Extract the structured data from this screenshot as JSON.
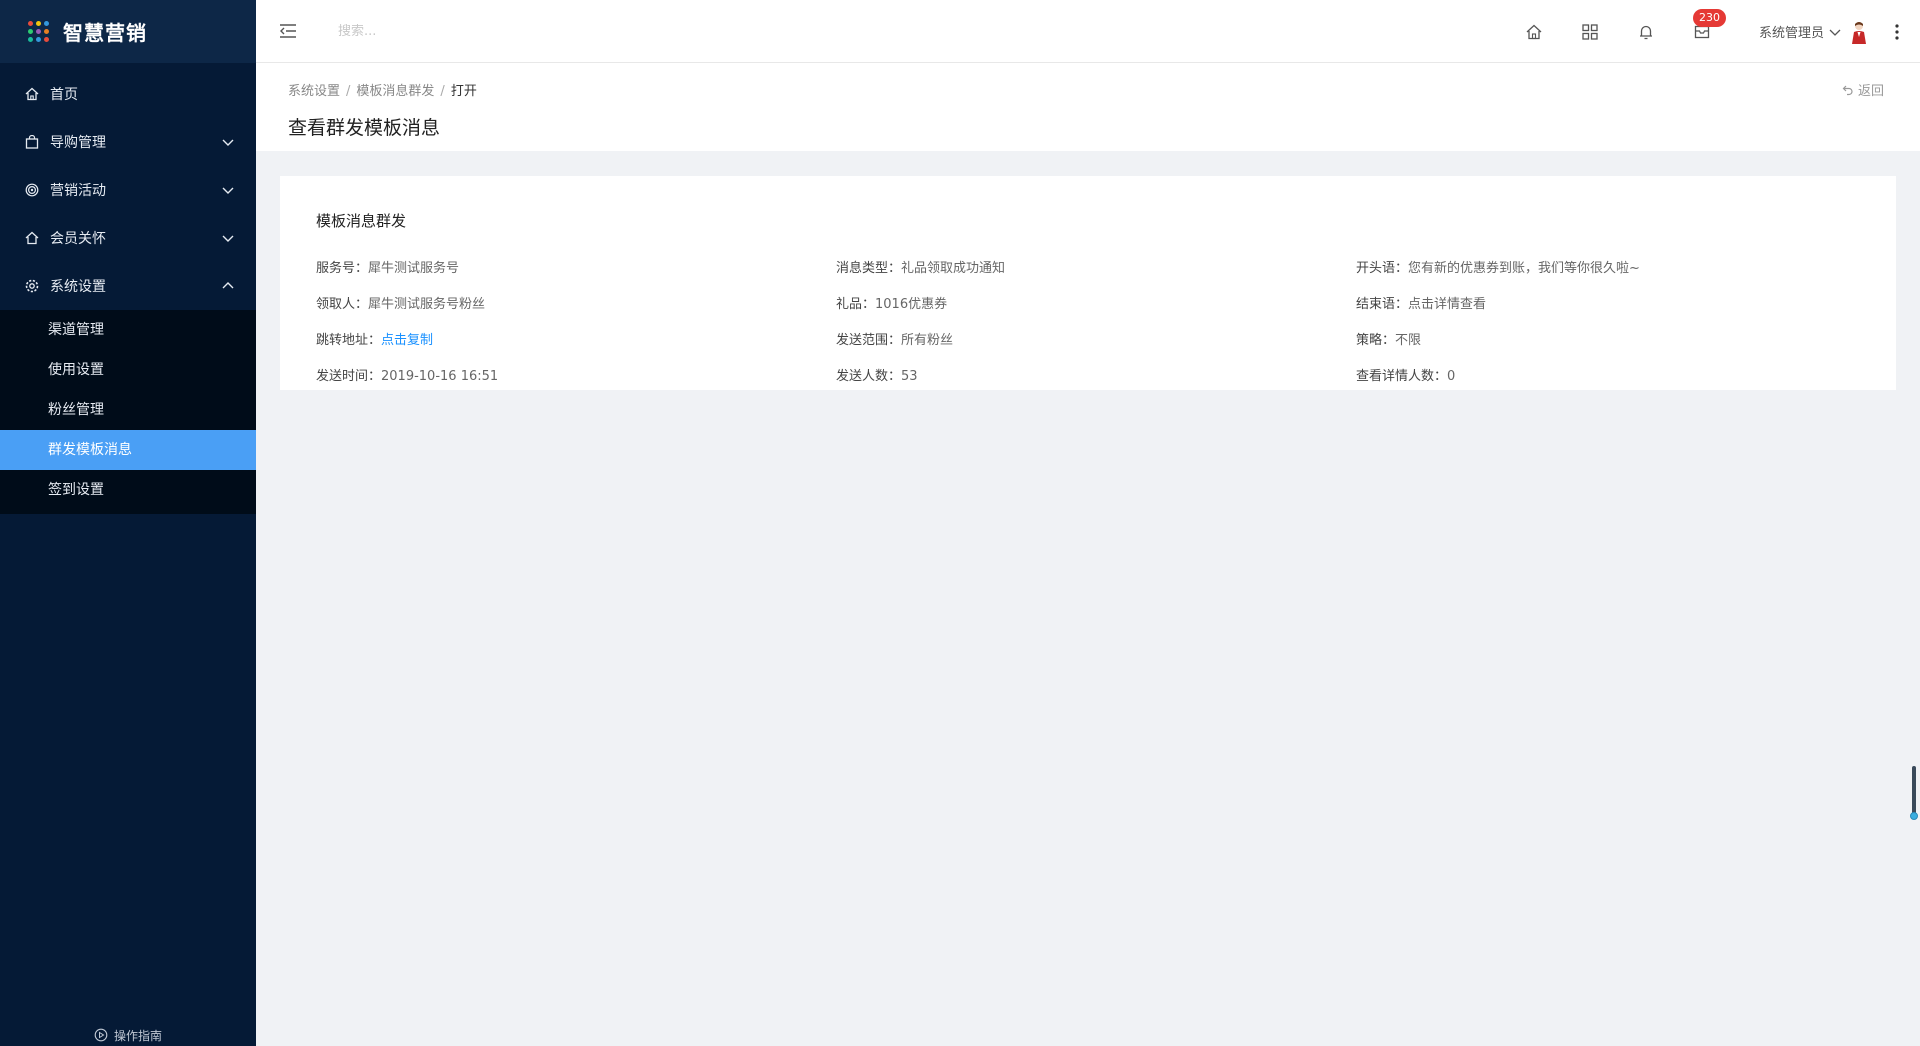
{
  "app": {
    "title": "智慧营销",
    "logo_dot_colors": [
      "#e74c3c",
      "#f1c40f",
      "#3498db",
      "#2ecc71",
      "#9b59b6",
      "#e67e22",
      "#1abc9c",
      "#3498db",
      "#e74c3c"
    ]
  },
  "sidebar": {
    "items": [
      {
        "label": "首页",
        "icon": "home-icon"
      },
      {
        "label": "导购管理",
        "icon": "bag-icon",
        "expandable": true,
        "expanded": false
      },
      {
        "label": "营销活动",
        "icon": "target-icon",
        "expandable": true,
        "expanded": false
      },
      {
        "label": "会员关怀",
        "icon": "house-heart-icon",
        "expandable": true,
        "expanded": false
      },
      {
        "label": "系统设置",
        "icon": "gear-icon",
        "expandable": true,
        "expanded": true
      }
    ],
    "subitems": [
      {
        "label": "渠道管理",
        "active": false
      },
      {
        "label": "使用设置",
        "active": false
      },
      {
        "label": "粉丝管理",
        "active": false
      },
      {
        "label": "群发模板消息",
        "active": true
      },
      {
        "label": "签到设置",
        "active": false
      }
    ],
    "guide_label": "操作指南",
    "active_color": "#4a9ff5"
  },
  "header": {
    "search_placeholder": "搜索...",
    "badge_count": "230",
    "user_name": "系统管理员"
  },
  "page": {
    "breadcrumb": [
      "系统设置",
      "模板消息群发",
      "打开"
    ],
    "title": "查看群发模板消息",
    "back_label": "返回"
  },
  "card": {
    "title": "模板消息群发",
    "rows": [
      [
        {
          "label": "服务号：",
          "value": "犀牛测试服务号"
        },
        {
          "label": "消息类型：",
          "value": "礼品领取成功通知"
        },
        {
          "label": "开头语：",
          "value": "您有新的优惠券到账，我们等你很久啦~"
        }
      ],
      [
        {
          "label": "领取人：",
          "value": "犀牛测试服务号粉丝"
        },
        {
          "label": "礼品：",
          "value": "1016优惠券"
        },
        {
          "label": "结束语：",
          "value": "点击详情查看"
        }
      ],
      [
        {
          "label": "跳转地址：",
          "value": "点击复制",
          "link": true
        },
        {
          "label": "发送范围：",
          "value": "所有粉丝"
        },
        {
          "label": "策略：",
          "value": "不限"
        }
      ],
      [
        {
          "label": "发送时间：",
          "value": "2019-10-16 16:51"
        },
        {
          "label": "发送人数：",
          "value": "53"
        },
        {
          "label": "查看详情人数：",
          "value": "0"
        }
      ]
    ]
  }
}
